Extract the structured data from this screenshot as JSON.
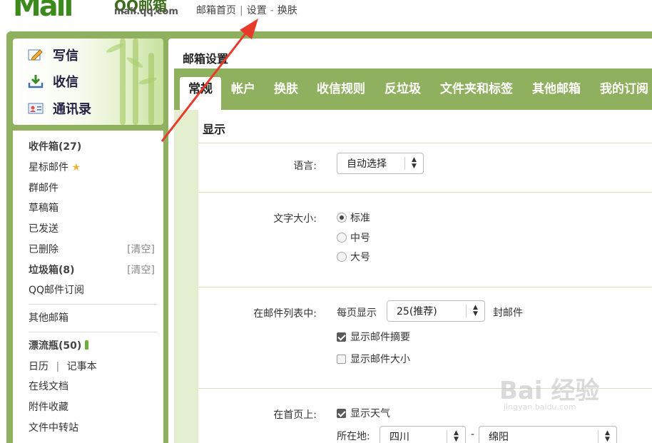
{
  "header": {
    "logo_text": "Mail",
    "logo_name": "QQ邮箱",
    "logo_domain": "mail.qq.com",
    "nav": [
      {
        "label": "邮箱首页"
      },
      {
        "label": "设置"
      },
      {
        "label": "换肤"
      }
    ],
    "sep1": "|",
    "sep2": "-"
  },
  "sidebar": {
    "actions": [
      {
        "label": "写信",
        "icon": "pencil-icon"
      },
      {
        "label": "收信",
        "icon": "inbox-download-icon"
      },
      {
        "label": "通讯录",
        "icon": "contact-card-icon"
      }
    ],
    "folders": {
      "inbox": "收件箱(27)",
      "starred": "星标邮件",
      "group": "群邮件",
      "drafts": "草稿箱",
      "sent": "已发送",
      "deleted": "已删除",
      "deleted_clear": "[清空]",
      "junk": "垃圾箱(8)",
      "junk_clear": "[清空]",
      "subscribe": "QQ邮件订阅",
      "other": "其他邮箱",
      "bottle": "漂流瓶(50)",
      "calendar": "日历",
      "cal_sep": "|",
      "notebook": "记事本",
      "docs": "在线文档",
      "attachments": "附件收藏",
      "transfer": "文件中转站"
    }
  },
  "main": {
    "title": "邮箱设置",
    "tabs": [
      {
        "label": "常规",
        "active": true
      },
      {
        "label": "帐户"
      },
      {
        "label": "换肤"
      },
      {
        "label": "收信规则"
      },
      {
        "label": "反垃圾"
      },
      {
        "label": "文件夹和标签"
      },
      {
        "label": "其他邮箱"
      },
      {
        "label": "我的订阅"
      }
    ],
    "section_title": "显示",
    "language": {
      "label": "语言:",
      "value": "自动选择"
    },
    "font_size": {
      "label": "文字大小:",
      "options": [
        {
          "label": "标准",
          "selected": true
        },
        {
          "label": "中号",
          "selected": false
        },
        {
          "label": "大号",
          "selected": false
        }
      ]
    },
    "mail_list": {
      "label": "在邮件列表中:",
      "per_page_prefix": "每页显示",
      "per_page_value": "25(推荐)",
      "per_page_suffix": "封邮件",
      "show_summary": {
        "label": "显示邮件摘要",
        "checked": true
      },
      "show_size": {
        "label": "显示邮件大小",
        "checked": false
      }
    },
    "home_page": {
      "label": "在首页上:",
      "show_weather": {
        "label": "显示天气",
        "checked": true
      },
      "location_label": "所在地:",
      "province": "四川",
      "dash": "-",
      "city": "绵阳"
    }
  },
  "watermark": {
    "brand": "Bai 经验",
    "url": "jingyan.baidu.com"
  },
  "colors": {
    "frame_green": "#8fb05e",
    "light_green": "#e4efcf",
    "annotation_arrow": "#e8392b"
  }
}
